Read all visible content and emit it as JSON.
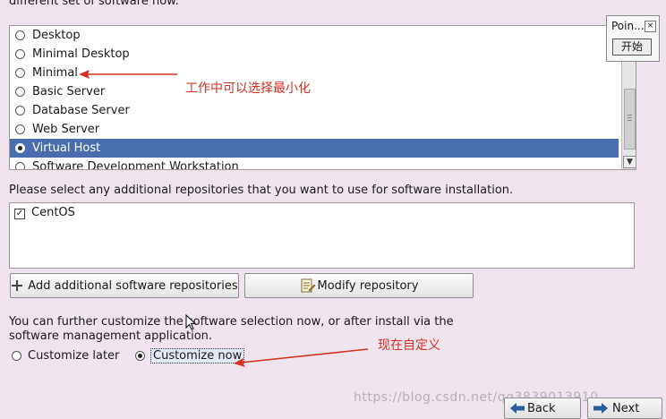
{
  "intro_text": "different set of software now.",
  "software_list": {
    "items": [
      {
        "label": "Desktop",
        "selected": false
      },
      {
        "label": "Minimal Desktop",
        "selected": false
      },
      {
        "label": "Minimal",
        "selected": false
      },
      {
        "label": "Basic Server",
        "selected": false
      },
      {
        "label": "Database Server",
        "selected": false
      },
      {
        "label": "Web Server",
        "selected": false
      },
      {
        "label": "Virtual Host",
        "selected": true
      },
      {
        "label": "Software Development Workstation",
        "selected": false
      }
    ],
    "selected_color": "#4a6db0"
  },
  "repositories": {
    "prompt": "Please select any additional repositories that you want to use for software installation.",
    "items": [
      {
        "label": "CentOS",
        "checked": true
      }
    ]
  },
  "buttons": {
    "add_repos": "Add additional software repositories",
    "modify_repo": "Modify repository"
  },
  "customize": {
    "info": "You can further customize the software selection now, or after install via the software management application.",
    "later_label": "Customize later",
    "now_label": "Customize now",
    "selected": "now"
  },
  "annotations": {
    "minimal_note": "工作中可以选择最小化",
    "customize_note": "现在自定义",
    "color": "#d63020"
  },
  "floating_window": {
    "title": "Poin...",
    "close_glyph": "×",
    "start_label": "开始"
  },
  "watermark": "https://blog.csdn.net/qq3839013910",
  "nav": {
    "back_label": "Back",
    "next_label": "Next"
  }
}
